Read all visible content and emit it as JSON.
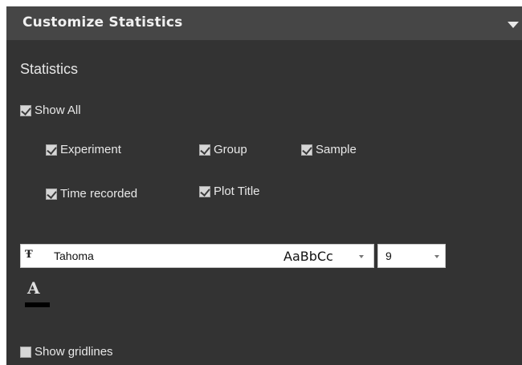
{
  "header": {
    "title": "Customize Statistics",
    "collapse_icon": "triangle-down-icon"
  },
  "statistics": {
    "title": "Statistics",
    "show_all": {
      "label": "Show All",
      "checked": true
    },
    "options": [
      {
        "label": "Experiment",
        "checked": true
      },
      {
        "label": "Group",
        "checked": true
      },
      {
        "label": "Sample",
        "checked": true
      },
      {
        "label": "Time recorded",
        "checked": true
      },
      {
        "label": "Plot Title",
        "checked": true
      }
    ]
  },
  "font": {
    "icon": "truetype-font-icon",
    "icon_glyph": "Ŧ",
    "name": "Tahoma",
    "sample": "AaBbCc",
    "size": "9",
    "color_letter": "A",
    "color": "#000000"
  },
  "gridlines": {
    "label": "Show gridlines",
    "checked": false
  },
  "colors": {
    "panel_bg": "#333333",
    "header_bg": "#464646"
  }
}
